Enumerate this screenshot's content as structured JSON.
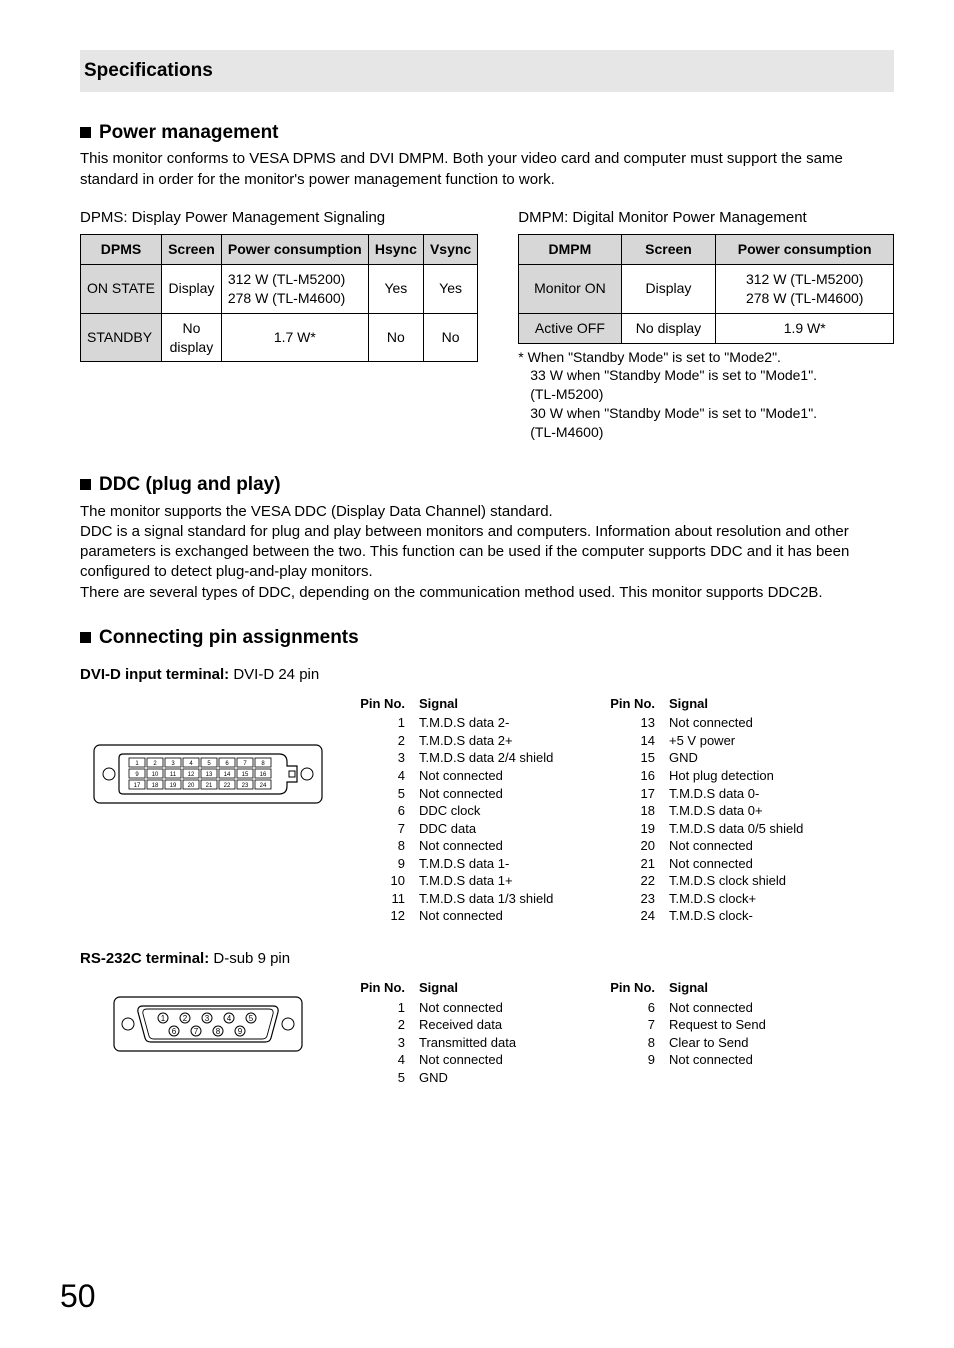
{
  "section_title": "Specifications",
  "power_management": {
    "heading": "Power management",
    "intro": "This monitor conforms to VESA DPMS and DVI DMPM. Both your video card and computer must support the same standard in order for the monitor's power management function to work.",
    "dpms": {
      "caption": "DPMS: Display Power Management Signaling",
      "headers": [
        "DPMS",
        "Screen",
        "Power consumption",
        "Hsync",
        "Vsync"
      ],
      "rows": [
        {
          "name": "ON STATE",
          "screen": "Display",
          "power_line1": "312 W (TL-M5200)",
          "power_line2": "278 W (TL-M4600)",
          "hsync": "Yes",
          "vsync": "Yes"
        },
        {
          "name": "STANDBY",
          "screen_line1": "No",
          "screen_line2": "display",
          "power": "1.7 W*",
          "hsync": "No",
          "vsync": "No"
        }
      ]
    },
    "dmpm": {
      "caption": "DMPM: Digital Monitor Power Management",
      "headers": [
        "DMPM",
        "Screen",
        "Power consumption"
      ],
      "rows": [
        {
          "name": "Monitor ON",
          "screen": "Display",
          "power_line1": "312 W (TL-M5200)",
          "power_line2": "278 W (TL-M4600)"
        },
        {
          "name": "Active OFF",
          "screen": "No display",
          "power": "1.9 W*"
        }
      ],
      "footnotes": [
        "* When \"Standby Mode\" is set to \"Mode2\".",
        "33 W when \"Standby Mode\" is set to \"Mode1\".",
        "(TL-M5200)",
        "30 W when \"Standby Mode\" is set to \"Mode1\".",
        "(TL-M4600)"
      ]
    }
  },
  "ddc": {
    "heading": "DDC (plug and play)",
    "p1": "The monitor supports the VESA DDC (Display Data Channel) standard.",
    "p2": "DDC is a signal standard for plug and play between monitors and computers. Information about resolution and other parameters is exchanged between the two. This function can be used if the computer supports DDC and it has been configured to detect plug-and-play monitors.",
    "p3": "There are several types of DDC, depending on the communication method used. This monitor supports DDC2B."
  },
  "connecting": {
    "heading": "Connecting pin assignments",
    "dvi": {
      "label_bold": "DVI-D input terminal:",
      "label_rest": " DVI-D 24 pin",
      "col_heads": [
        "Pin No.",
        "Signal",
        "Pin No.",
        "Signal"
      ],
      "left": [
        {
          "n": "1",
          "s": "T.M.D.S data 2-"
        },
        {
          "n": "2",
          "s": "T.M.D.S data 2+"
        },
        {
          "n": "3",
          "s": "T.M.D.S data 2/4 shield"
        },
        {
          "n": "4",
          "s": "Not connected"
        },
        {
          "n": "5",
          "s": "Not connected"
        },
        {
          "n": "6",
          "s": "DDC clock"
        },
        {
          "n": "7",
          "s": "DDC data"
        },
        {
          "n": "8",
          "s": "Not connected"
        },
        {
          "n": "9",
          "s": "T.M.D.S data 1-"
        },
        {
          "n": "10",
          "s": "T.M.D.S data 1+"
        },
        {
          "n": "11",
          "s": "T.M.D.S data 1/3 shield"
        },
        {
          "n": "12",
          "s": "Not connected"
        }
      ],
      "right": [
        {
          "n": "13",
          "s": "Not connected"
        },
        {
          "n": "14",
          "s": "+5 V power"
        },
        {
          "n": "15",
          "s": "GND"
        },
        {
          "n": "16",
          "s": "Hot plug detection"
        },
        {
          "n": "17",
          "s": "T.M.D.S data 0-"
        },
        {
          "n": "18",
          "s": "T.M.D.S data 0+"
        },
        {
          "n": "19",
          "s": "T.M.D.S data 0/5 shield"
        },
        {
          "n": "20",
          "s": "Not connected"
        },
        {
          "n": "21",
          "s": "Not connected"
        },
        {
          "n": "22",
          "s": "T.M.D.S clock shield"
        },
        {
          "n": "23",
          "s": "T.M.D.S clock+"
        },
        {
          "n": "24",
          "s": "T.M.D.S clock-"
        }
      ]
    },
    "rs232c": {
      "label_bold": "RS-232C terminal:",
      "label_rest": " D-sub 9 pin",
      "col_heads": [
        "Pin No.",
        "Signal",
        "Pin No.",
        "Signal"
      ],
      "left": [
        {
          "n": "1",
          "s": "Not connected"
        },
        {
          "n": "2",
          "s": "Received data"
        },
        {
          "n": "3",
          "s": "Transmitted data"
        },
        {
          "n": "4",
          "s": "Not connected"
        },
        {
          "n": "5",
          "s": "GND"
        }
      ],
      "right": [
        {
          "n": "6",
          "s": "Not connected"
        },
        {
          "n": "7",
          "s": "Request to Send"
        },
        {
          "n": "8",
          "s": "Clear to Send"
        },
        {
          "n": "9",
          "s": "Not connected"
        }
      ]
    }
  },
  "page_number": "50"
}
